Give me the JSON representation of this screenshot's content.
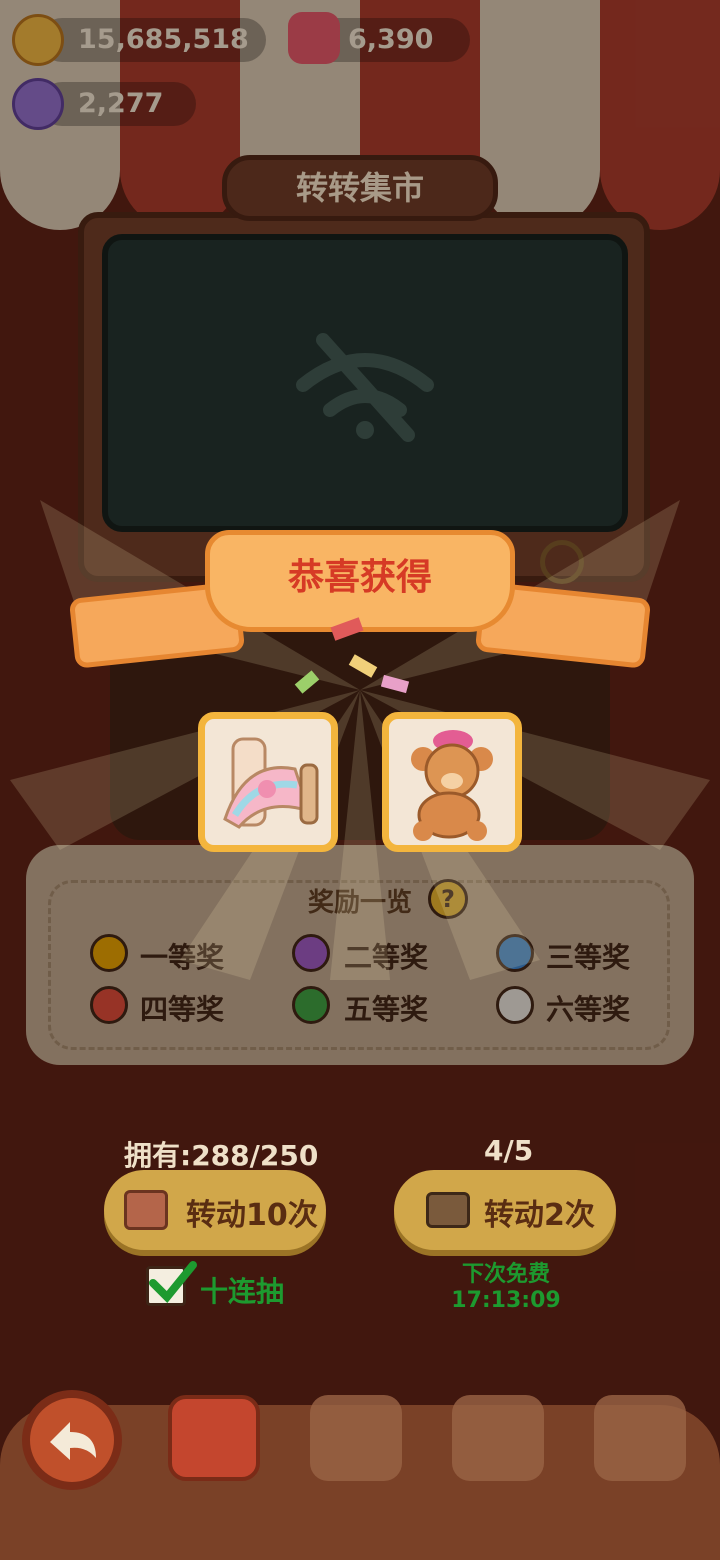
{
  "currency": {
    "cookies": "15,685,518",
    "gems": "6,390",
    "candy": "2,277"
  },
  "title": "转转集市",
  "banner": "恭喜获得",
  "rewards": {
    "title": "奖励一览",
    "help_icon": "question-mark-icon",
    "prizes": [
      {
        "label": "一等奖",
        "color": "#e6a400"
      },
      {
        "label": "二等奖",
        "color": "#9b59c6"
      },
      {
        "label": "三等奖",
        "color": "#3a88d6"
      },
      {
        "label": "四等奖",
        "color": "#dd4b3a"
      },
      {
        "label": "五等奖",
        "color": "#3aa243"
      },
      {
        "label": "六等奖",
        "color": "#e9e6e0"
      }
    ]
  },
  "won_items": [
    {
      "name": "slide-item-icon"
    },
    {
      "name": "teddy-bear-item-icon"
    }
  ],
  "spin": {
    "owned": "拥有:288/250",
    "spin10_label": "转动10次",
    "free_count": "4/5",
    "spin2_label": "转动2次",
    "ten_draw_label": "十连抽",
    "ten_draw_checked": true,
    "next_free_label": "下次免费",
    "next_free_time": "17:13:09"
  },
  "colors": {
    "accent": "#d1a74a",
    "banner": "#f9b564",
    "green_text": "#1d9a2f"
  }
}
